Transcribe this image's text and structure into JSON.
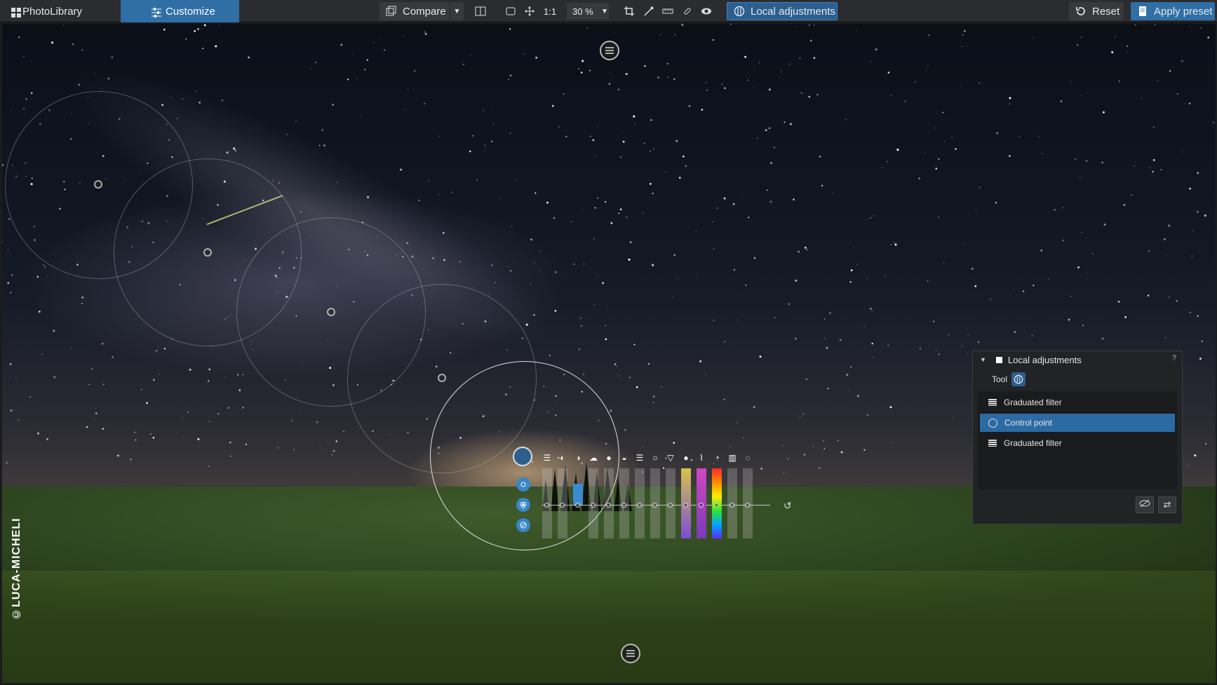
{
  "toolbar": {
    "photolibrary_label": "PhotoLibrary",
    "customize_label": "Customize",
    "compare_label": "Compare",
    "one_to_one_label": "1:1",
    "zoom_value": "30 %",
    "local_adjustments_label": "Local adjustments",
    "reset_label": "Reset",
    "apply_preset_label": "Apply preset"
  },
  "image": {
    "watermark": "©LUCA-MICHELI"
  },
  "panel": {
    "title": "Local adjustments",
    "help": "?",
    "tool_label": "Tool",
    "items": [
      {
        "label": "Graduated filter",
        "icon": "graduated-filter-icon",
        "selected": false
      },
      {
        "label": "Control point",
        "icon": "control-point-icon",
        "selected": true
      },
      {
        "label": "Graduated filter",
        "icon": "graduated-filter-icon",
        "selected": false
      }
    ]
  },
  "colors": {
    "accent": "#2f6fa6",
    "selection": "#2c6aa3",
    "toolbar_bg": "#2b2c2f"
  }
}
